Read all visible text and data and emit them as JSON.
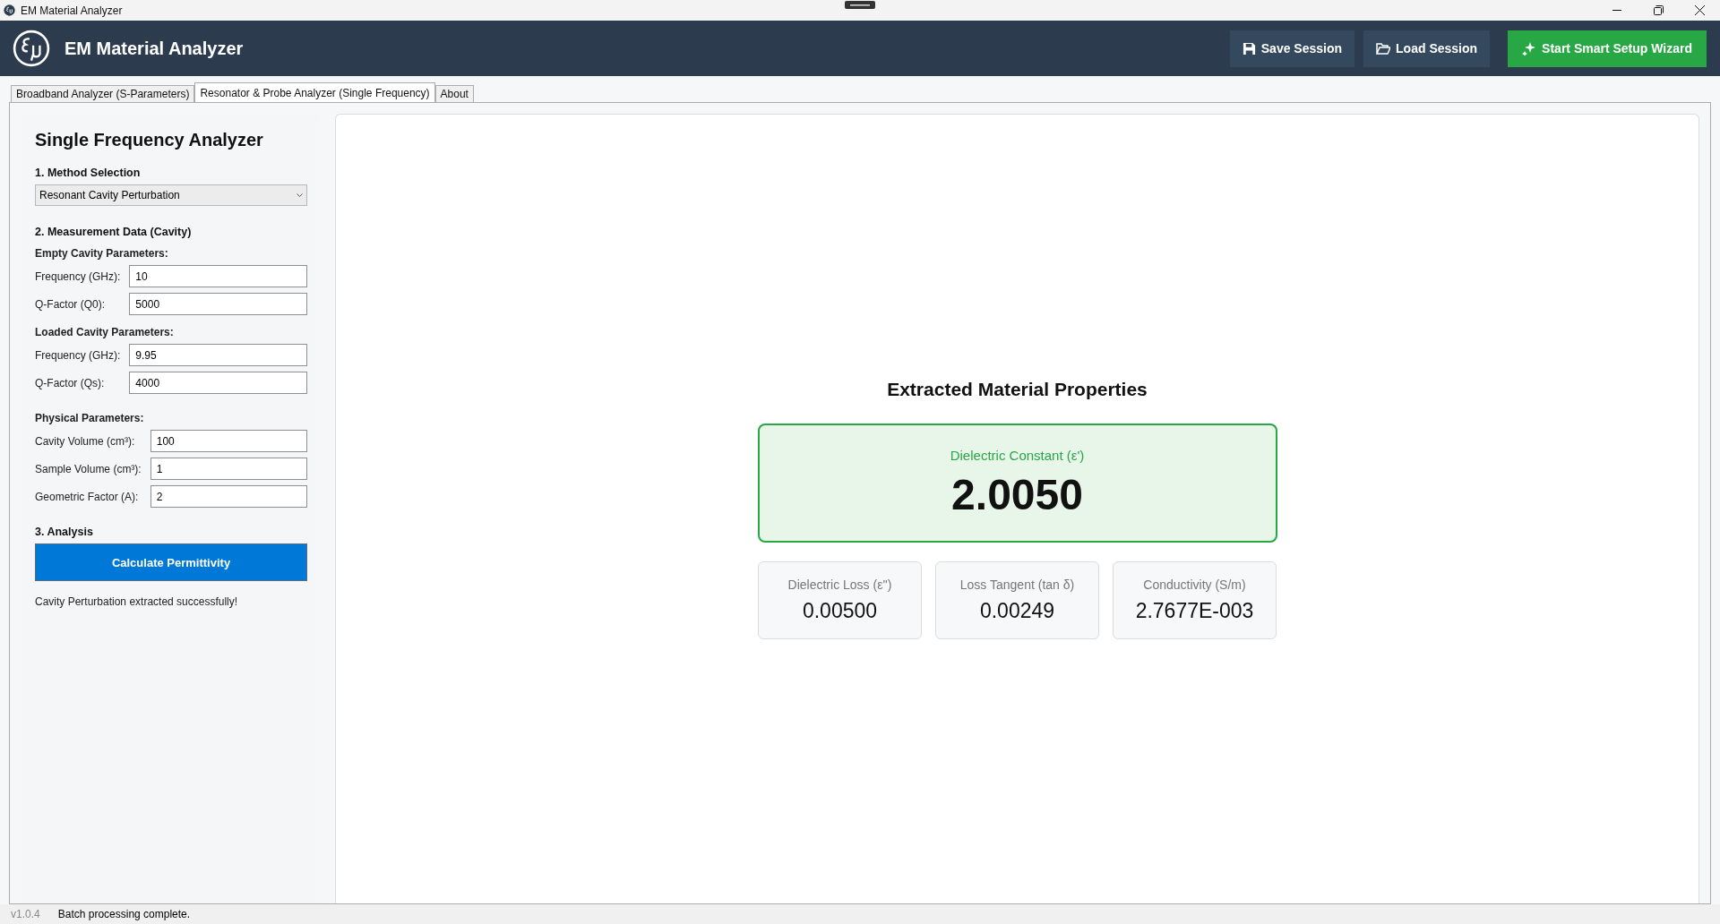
{
  "window": {
    "title": "EM Material Analyzer"
  },
  "header": {
    "title": "EM Material Analyzer",
    "buttons": [
      {
        "label": "Save Session",
        "kind": "save"
      },
      {
        "label": "Load Session",
        "kind": "load"
      },
      {
        "label": "Start Smart Setup Wizard",
        "kind": "wizard"
      }
    ]
  },
  "tabs": [
    {
      "label": "Broadband Analyzer (S-Parameters)",
      "selected": false
    },
    {
      "label": "Resonator & Probe Analyzer (Single Frequency)",
      "selected": true
    },
    {
      "label": "About",
      "selected": false
    }
  ],
  "panel": {
    "title": "Single Frequency Analyzer",
    "method": {
      "heading": "1. Method Selection",
      "value": "Resonant Cavity Perturbation"
    },
    "measurement": {
      "heading": "2. Measurement Data (Cavity)",
      "groups": [
        {
          "title": "Empty Cavity Parameters:",
          "fields": [
            {
              "label": "Frequency (GHz):",
              "value": "10"
            },
            {
              "label": "Q-Factor (Q0):",
              "value": "5000"
            }
          ]
        },
        {
          "title": "Loaded Cavity Parameters:",
          "fields": [
            {
              "label": "Frequency (GHz):",
              "value": "9.95"
            },
            {
              "label": "Q-Factor (Qs):",
              "value": "4000"
            }
          ]
        },
        {
          "title": "Physical Parameters:",
          "fields": [
            {
              "label": "Cavity Volume (cm³):",
              "value": "100"
            },
            {
              "label": "Sample Volume (cm³):",
              "value": "1"
            },
            {
              "label": "Geometric Factor (A):",
              "value": "2"
            }
          ]
        }
      ]
    },
    "analysis": {
      "heading": "3. Analysis",
      "button": "Calculate Permittivity",
      "message": "Cavity Perturbation extracted successfully!"
    }
  },
  "results": {
    "title": "Extracted Material Properties",
    "primary": {
      "label": "Dielectric Constant (ε')",
      "value": "2.0050"
    },
    "secondary": [
      {
        "label": "Dielectric Loss (ε'')",
        "value": "0.00500"
      },
      {
        "label": "Loss Tangent (tan δ)",
        "value": "0.00249"
      },
      {
        "label": "Conductivity (S/m)",
        "value": "2.7677E-003"
      }
    ]
  },
  "status_bar": {
    "version": "v1.0.4",
    "message": "Batch processing complete."
  }
}
